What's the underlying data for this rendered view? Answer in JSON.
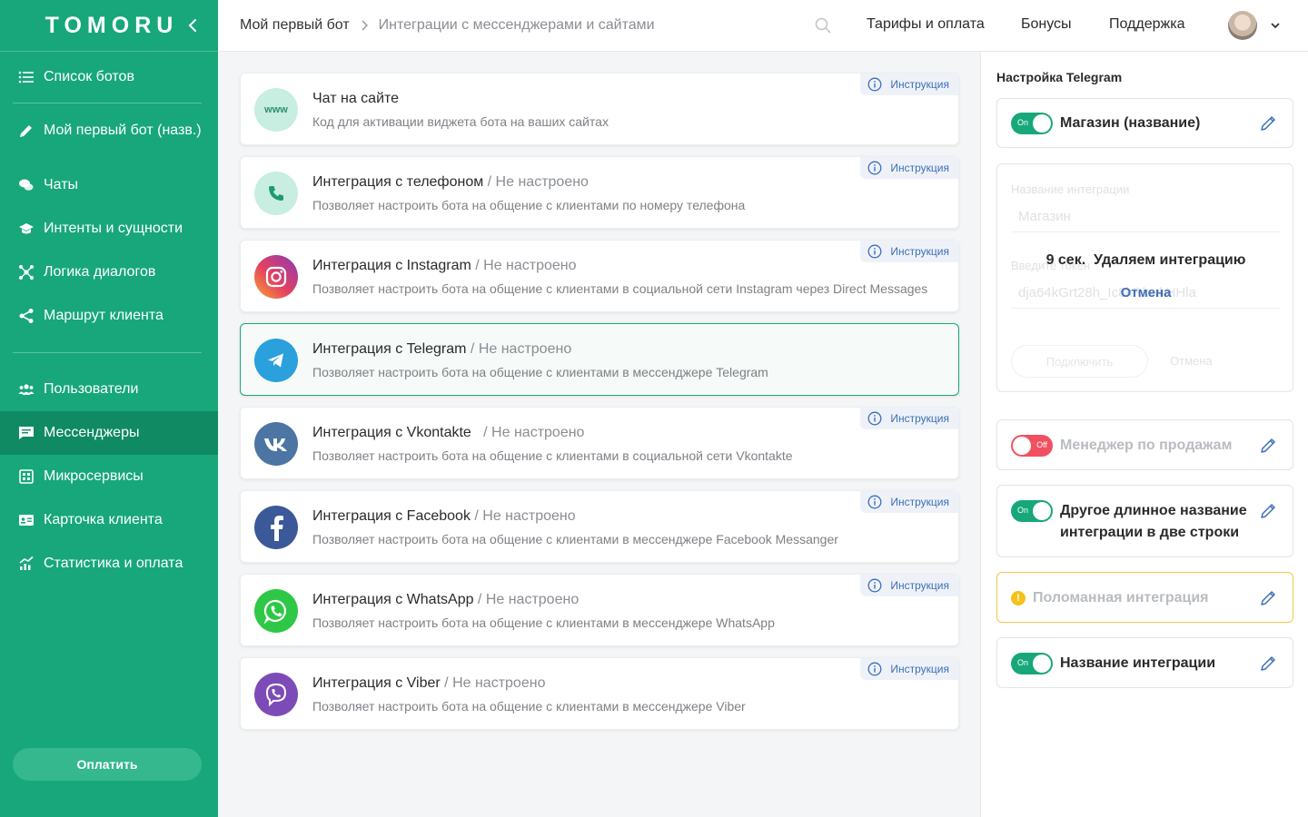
{
  "brand": {
    "logo": "TOMORU",
    "accent": "#17a77a"
  },
  "sidebar": {
    "items": [
      {
        "label": "Список ботов",
        "icon": "list-icon"
      },
      {
        "label": "Мой первый бот  (назв.)",
        "icon": "pencil-icon"
      },
      {
        "label": "Чаты",
        "icon": "chat-icon"
      },
      {
        "label": "Интенты и сущности",
        "icon": "graduation-cap-icon"
      },
      {
        "label": "Логика диалогов",
        "icon": "network-icon"
      },
      {
        "label": "Маршрут клиента",
        "icon": "share-icon"
      },
      {
        "label": "Пользователи",
        "icon": "users-icon"
      },
      {
        "label": "Мессенджеры",
        "icon": "message-icon",
        "active": true
      },
      {
        "label": "Микросервисы",
        "icon": "chip-icon"
      },
      {
        "label": "Карточка клиента",
        "icon": "id-card-icon"
      },
      {
        "label": "Статистика и оплата",
        "icon": "stats-icon"
      }
    ],
    "pay_label": "Оплатить"
  },
  "header": {
    "crumb_bot": "Мой первый бот",
    "crumb_page": "Интеграции с мессенджерами и сайтами",
    "links": [
      "Тарифы и оплата",
      "Бонусы",
      "Поддержка"
    ]
  },
  "integrations": [
    {
      "title": "Чат на сайте",
      "status": "",
      "desc": "Код для активации виджета бота на ваших сайтах",
      "instr": "Инструкция",
      "icon": "www-icon"
    },
    {
      "title": "Интеграция с телефоном",
      "status": " / Не настроено",
      "desc": "Позволяет настроить бота на общение с клиентами по номеру телефона",
      "instr": "Инструкция",
      "icon": "phone-icon"
    },
    {
      "title": "Интеграция с Instagram",
      "status": " / Не настроено",
      "desc": "Позволяет настроить бота на общение с клиентами в социальной сети Instagram через Direct Messages",
      "instr": "Инструкция",
      "icon": "instagram-icon"
    },
    {
      "title": "Интеграция с Telegram",
      "status": " / Не настроено",
      "desc": "Позволяет настроить бота на общение с клиентами в мессенджере Telegram",
      "instr": "",
      "icon": "telegram-icon"
    },
    {
      "title": "Интеграция с Vkontakte",
      "status": "   / Не настроено",
      "desc": "Позволяет настроить бота на общение с клиентами в социальной сети Vkontakte",
      "instr": "Инструкция",
      "icon": "vk-icon"
    },
    {
      "title": "Интеграция с Facebook",
      "status": " / Не настроено",
      "desc": "Позволяет настроить бота на общение с клиентами в мессенджере Facebook Messanger",
      "instr": "Инструкция",
      "icon": "facebook-icon"
    },
    {
      "title": "Интеграция с WhatsApp",
      "status": " / Не настроено",
      "desc": "Позволяет настроить бота на общение с клиентами в мессенджере WhatsApp",
      "instr": "Инструкция",
      "icon": "whatsapp-icon"
    },
    {
      "title": "Интеграция с Viber",
      "status": " / Не настроено",
      "desc": "Позволяет настроить бота на общение с клиентами в мессенджере Viber",
      "instr": "Инструкция",
      "icon": "viber-icon"
    }
  ],
  "panel": {
    "title": "Настройка Telegram",
    "shop": {
      "toggle": "On",
      "name": "Магазин (название)"
    },
    "deleting": {
      "ghost_label1": "Название интеграции",
      "ghost_value1": "Магазин",
      "ghost_label2": "Введите токен",
      "ghost_value2": "dja64kGrt28h_Ic8kRkwkHHla",
      "ghost_connect": "Подключить",
      "ghost_cancel": "Отмена",
      "countdown": "9 сек.",
      "message": "Удаляем интеграцию",
      "cancel": "Отмена"
    },
    "manager": {
      "toggle": "Off",
      "name": "Менеджер по продажам"
    },
    "long": {
      "toggle": "On",
      "name_line1": "Другое длинное название",
      "name_line2": "интеграции в две строки"
    },
    "broken": {
      "name": "Поломанная интеграция"
    },
    "last": {
      "toggle": "On",
      "name": "Название интеграции"
    }
  }
}
